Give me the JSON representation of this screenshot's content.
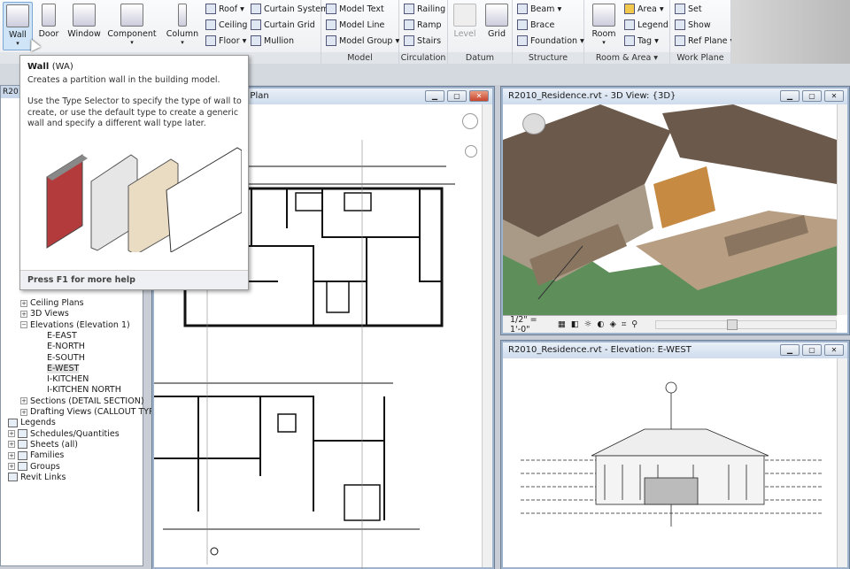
{
  "ribbon": {
    "build": {
      "wall": "Wall",
      "door": "Door",
      "window": "Window",
      "component": "Component",
      "column": "Column",
      "roof": "Roof",
      "ceiling": "Ceiling",
      "floor": "Floor",
      "curtain_system": "Curtain System",
      "curtain_grid": "Curtain Grid",
      "mullion": "Mullion"
    },
    "model": {
      "label": "Model",
      "model_text": "Model Text",
      "model_line": "Model Line",
      "model_group": "Model Group"
    },
    "circulation": {
      "label": "Circulation",
      "railing": "Railing",
      "ramp": "Ramp",
      "stairs": "Stairs"
    },
    "datum": {
      "label": "Datum",
      "level": "Level",
      "grid": "Grid"
    },
    "structure": {
      "label": "Structure",
      "beam": "Beam",
      "brace": "Brace",
      "foundation": "Foundation"
    },
    "room_area": {
      "label": "Room & Area",
      "room": "Room",
      "area": "Area",
      "legend": "Legend",
      "tag": "Tag"
    },
    "work_plane": {
      "label": "Work Plane",
      "set": "Set",
      "show": "Show",
      "ref_plane": "Ref Plane"
    }
  },
  "tooltip": {
    "title": "Wall",
    "shortcut": "(WA)",
    "summary": "Creates a partition wall in the building model.",
    "detail": "Use the Type Selector to specify the type of wall to create, or use the default type to create a generic wall and specify a different wall type later.",
    "footer": "Press F1 for more help"
  },
  "browser": {
    "title": "R2010",
    "items": [
      {
        "label": "Ceiling Plans",
        "level": 2,
        "toggle": "+"
      },
      {
        "label": "3D Views",
        "level": 2,
        "toggle": "+"
      },
      {
        "label": "Elevations (Elevation 1)",
        "level": 2,
        "toggle": "-"
      },
      {
        "label": "E-EAST",
        "level": 3
      },
      {
        "label": "E-NORTH",
        "level": 3
      },
      {
        "label": "E-SOUTH",
        "level": 3
      },
      {
        "label": "E-WEST",
        "level": 3,
        "selected": true
      },
      {
        "label": "I-KITCHEN",
        "level": 3
      },
      {
        "label": "I-KITCHEN NORTH",
        "level": 3
      },
      {
        "label": "Sections (DETAIL SECTION)",
        "level": 2,
        "toggle": "+"
      },
      {
        "label": "Drafting Views (CALLOUT TYP.",
        "level": 2,
        "toggle": "+"
      },
      {
        "label": "Legends",
        "level": 1
      },
      {
        "label": "Schedules/Quantities",
        "level": 1,
        "toggle": "+"
      },
      {
        "label": "Sheets (all)",
        "level": 1,
        "toggle": "+"
      },
      {
        "label": "Families",
        "level": 1,
        "toggle": "+"
      },
      {
        "label": "Groups",
        "level": 1,
        "toggle": "+"
      },
      {
        "label": "Revit Links",
        "level": 1
      }
    ]
  },
  "views": {
    "floor_plan": {
      "title": "loor Plan: First Floor Plan"
    },
    "view_3d": {
      "title": "R2010_Residence.rvt - 3D View: {3D}",
      "scale": "1/2\" = 1'-0\""
    },
    "elevation": {
      "title": "R2010_Residence.rvt - Elevation: E-WEST"
    }
  },
  "colors": {
    "accent": "#cfe4f7",
    "roof": "#6b5a4c",
    "lawn": "#5e8f5a",
    "wall": "#a89a86"
  }
}
